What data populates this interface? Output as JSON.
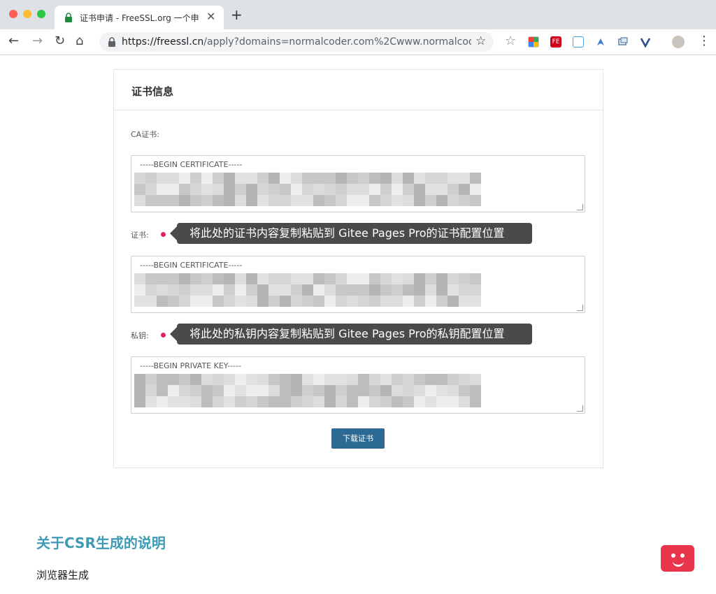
{
  "browser": {
    "tab_title": "证书申请 - FreeSSL.org 一个申",
    "tab_close": "✕",
    "new_tab": "+",
    "url_host": "https://freessl.cn",
    "url_rest": "/apply?domains=normalcoder.com%2Cwww.normalcoder...",
    "nav": {
      "back": "←",
      "forward": "→",
      "reload": "↻",
      "home": "⌂"
    },
    "star": "☆",
    "menu": "⋮",
    "extensions": [
      "FE"
    ]
  },
  "card": {
    "title": "证书信息",
    "ca_label": "CA证书:",
    "ca_text": "-----BEGIN CERTIFICATE-----",
    "cert_label": "证书:",
    "cert_callout": "将此处的证书内容复制粘贴到 Gitee Pages Pro的证书配置位置",
    "cert_text": "-----BEGIN CERTIFICATE-----",
    "key_label": "私钥:",
    "key_callout": "将此处的私钥内容复制粘贴到 Gitee Pages Pro的私钥配置位置",
    "key_text": "-----BEGIN PRIVATE KEY-----",
    "download_button": "下载证书"
  },
  "section": {
    "title": "关于CSR生成的说明",
    "subtitle": "浏览器生成"
  },
  "colors": {
    "accent": "#2c6a94",
    "heading": "#3f9ab5",
    "callout_bg": "#4a4a4a",
    "dot": "#e0245e",
    "bot": "#e8354c"
  }
}
